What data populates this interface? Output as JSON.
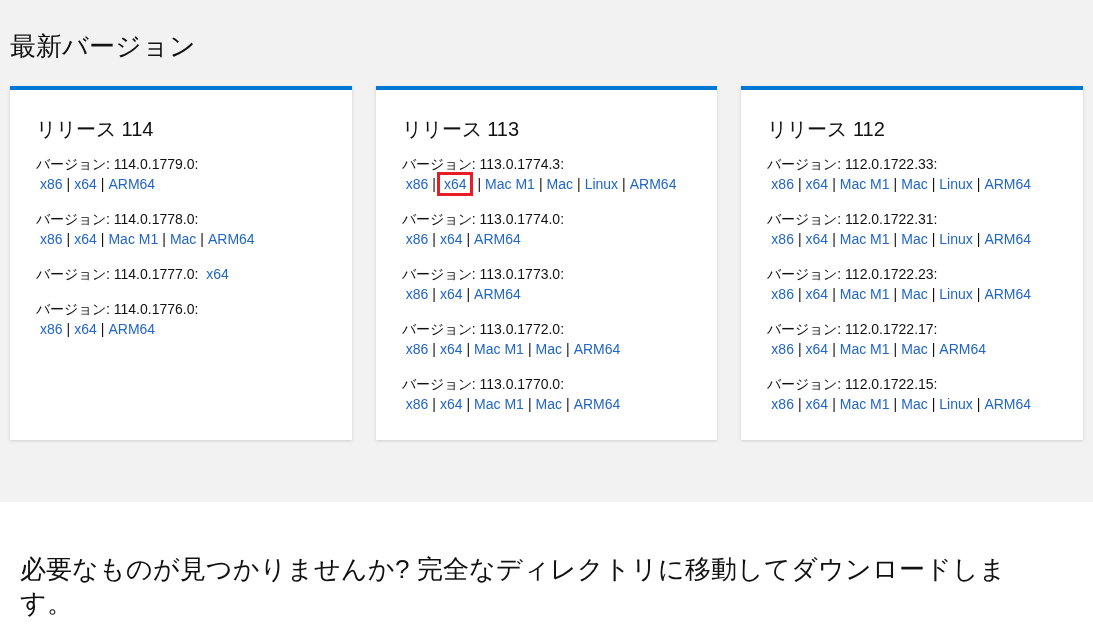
{
  "heading": "最新バージョン",
  "releases": [
    {
      "title": "リリース 114",
      "versions": [
        {
          "label": "バージョン: 114.0.1779.0:",
          "links": [
            {
              "text": "x86",
              "separator": "|",
              "highlighted": false
            },
            {
              "text": "x64",
              "separator": "|",
              "highlighted": false
            },
            {
              "text": "ARM64",
              "highlighted": false
            }
          ]
        },
        {
          "label": "バージョン: 114.0.1778.0:",
          "links": [
            {
              "text": "x86",
              "separator": "|",
              "highlighted": false
            },
            {
              "text": "x64",
              "separator": "|",
              "highlighted": false
            },
            {
              "text": "Mac M1",
              "separator": "|",
              "highlighted": false
            },
            {
              "text": "Mac",
              "separator": "|",
              "highlighted": false
            },
            {
              "text": "ARM64",
              "highlighted": false
            }
          ]
        },
        {
          "label": "バージョン: 114.0.1777.0:",
          "links": [
            {
              "text": "x64",
              "highlighted": false
            }
          ]
        },
        {
          "label": "バージョン: 114.0.1776.0:",
          "links": [
            {
              "text": "x86",
              "separator": "|",
              "highlighted": false
            },
            {
              "text": "x64",
              "separator": "|",
              "highlighted": false
            },
            {
              "text": "ARM64",
              "highlighted": false
            }
          ]
        }
      ]
    },
    {
      "title": "リリース 113",
      "versions": [
        {
          "label": "バージョン: 113.0.1774.3:",
          "links": [
            {
              "text": "x86",
              "separator": "|",
              "highlighted": false
            },
            {
              "text": "x64",
              "separator": "|",
              "highlighted": true
            },
            {
              "text": "Mac M1",
              "separator": "|",
              "highlighted": false
            },
            {
              "text": "Mac",
              "separator": "|",
              "highlighted": false
            },
            {
              "text": "Linux",
              "separator": "|",
              "highlighted": false
            },
            {
              "text": "ARM64",
              "highlighted": false
            }
          ]
        },
        {
          "label": "バージョン: 113.0.1774.0:",
          "links": [
            {
              "text": "x86",
              "separator": "|",
              "highlighted": false
            },
            {
              "text": "x64",
              "separator": "|",
              "highlighted": false
            },
            {
              "text": "ARM64",
              "highlighted": false
            }
          ]
        },
        {
          "label": "バージョン: 113.0.1773.0:",
          "links": [
            {
              "text": "x86",
              "separator": "|",
              "highlighted": false
            },
            {
              "text": "x64",
              "separator": "|",
              "highlighted": false
            },
            {
              "text": "ARM64",
              "highlighted": false
            }
          ]
        },
        {
          "label": "バージョン: 113.0.1772.0:",
          "links": [
            {
              "text": "x86",
              "separator": "|",
              "highlighted": false
            },
            {
              "text": "x64",
              "separator": "|",
              "highlighted": false
            },
            {
              "text": "Mac M1",
              "separator": "|",
              "highlighted": false
            },
            {
              "text": "Mac",
              "separator": "|",
              "highlighted": false
            },
            {
              "text": "ARM64",
              "highlighted": false
            }
          ]
        },
        {
          "label": "バージョン: 113.0.1770.0:",
          "links": [
            {
              "text": "x86",
              "separator": "|",
              "highlighted": false
            },
            {
              "text": "x64",
              "separator": "|",
              "highlighted": false
            },
            {
              "text": "Mac M1",
              "separator": "|",
              "highlighted": false
            },
            {
              "text": "Mac",
              "separator": "|",
              "highlighted": false
            },
            {
              "text": "ARM64",
              "highlighted": false
            }
          ]
        }
      ]
    },
    {
      "title": "リリース 112",
      "versions": [
        {
          "label": "バージョン: 112.0.1722.33:",
          "links": [
            {
              "text": "x86",
              "separator": "|",
              "highlighted": false
            },
            {
              "text": "x64",
              "separator": "|",
              "highlighted": false
            },
            {
              "text": "Mac M1",
              "separator": "|",
              "highlighted": false
            },
            {
              "text": "Mac",
              "separator": "|",
              "highlighted": false
            },
            {
              "text": "Linux",
              "separator": "|",
              "highlighted": false
            },
            {
              "text": "ARM64",
              "highlighted": false
            }
          ]
        },
        {
          "label": "バージョン: 112.0.1722.31:",
          "links": [
            {
              "text": "x86",
              "separator": "|",
              "highlighted": false
            },
            {
              "text": "x64",
              "separator": "|",
              "highlighted": false
            },
            {
              "text": "Mac M1",
              "separator": "|",
              "highlighted": false
            },
            {
              "text": "Mac",
              "separator": "|",
              "highlighted": false
            },
            {
              "text": "Linux",
              "separator": "|",
              "highlighted": false
            },
            {
              "text": "ARM64",
              "highlighted": false
            }
          ]
        },
        {
          "label": "バージョン: 112.0.1722.23:",
          "links": [
            {
              "text": "x86",
              "separator": "|",
              "highlighted": false
            },
            {
              "text": "x64",
              "separator": "|",
              "highlighted": false
            },
            {
              "text": "Mac M1",
              "separator": "|",
              "highlighted": false
            },
            {
              "text": "Mac",
              "separator": "|",
              "highlighted": false
            },
            {
              "text": "Linux",
              "separator": "|",
              "highlighted": false
            },
            {
              "text": "ARM64",
              "highlighted": false
            }
          ]
        },
        {
          "label": "バージョン: 112.0.1722.17:",
          "links": [
            {
              "text": "x86",
              "separator": "|",
              "highlighted": false
            },
            {
              "text": "x64",
              "separator": "|",
              "highlighted": false
            },
            {
              "text": "Mac M1",
              "separator": "|",
              "highlighted": false
            },
            {
              "text": "Mac",
              "separator": "|",
              "highlighted": false
            },
            {
              "text": "ARM64",
              "highlighted": false
            }
          ]
        },
        {
          "label": "バージョン: 112.0.1722.15:",
          "links": [
            {
              "text": "x86",
              "separator": "|",
              "highlighted": false
            },
            {
              "text": "x64",
              "separator": "|",
              "highlighted": false
            },
            {
              "text": "Mac M1",
              "separator": "|",
              "highlighted": false
            },
            {
              "text": "Mac",
              "separator": "|",
              "highlighted": false
            },
            {
              "text": "Linux",
              "separator": "|",
              "highlighted": false
            },
            {
              "text": "ARM64",
              "highlighted": false
            }
          ]
        }
      ]
    }
  ],
  "footer_text": "必要なものが見つかりませんか? 完全なディレクトリに移動してダウンロードします。"
}
